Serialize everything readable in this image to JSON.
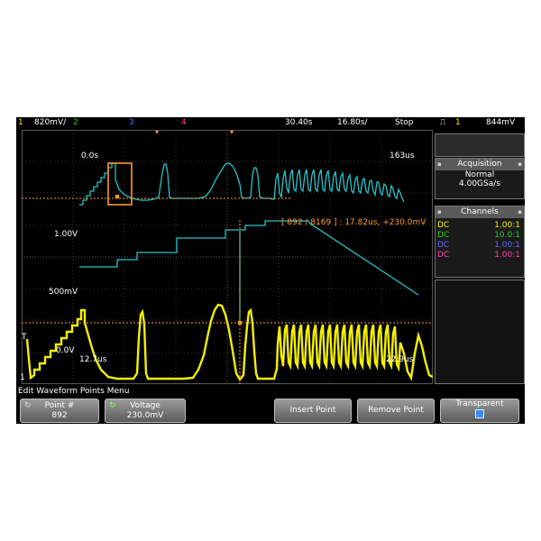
{
  "status_bar": {
    "ch1_num": "1",
    "ch1_scale": "820mV/",
    "ch2_num": "2",
    "ch3_num": "3",
    "ch4_num": "4",
    "timebase_delay": "30.40s",
    "timebase_scale": "16.80s/",
    "run_state": "Stop",
    "trigger_source": "1",
    "trigger_level": "844mV"
  },
  "waveform": {
    "time_start": "0.0s",
    "time_end": "163us",
    "ch_top_ref": "1.00V",
    "ch_mid_ref": "500mV",
    "zero_level": "0.0V",
    "cursor_left": "12.7us",
    "cursor_right": "22.9us",
    "point_readout": "[ 892 / 8169 ] : 17.82us, +230.0mV",
    "ground_marker": "1",
    "trigger_marker": "T"
  },
  "acquisition": {
    "title": "Acquisition",
    "mode": "Normal",
    "rate": "4.00GSa/s"
  },
  "channels": {
    "title": "Channels",
    "rows": [
      {
        "coupling": "DC",
        "ratio": "1.00:1",
        "color": "#f4f000"
      },
      {
        "coupling": "DC",
        "ratio": "10.0:1",
        "color": "#29d31f"
      },
      {
        "coupling": "DC",
        "ratio": "1.00:1",
        "color": "#5f6bff"
      },
      {
        "coupling": "DC",
        "ratio": "1.00:1",
        "color": "#ff3fa6"
      }
    ]
  },
  "menu": {
    "title": "Edit Waveform Points Menu",
    "point_label": "Point #",
    "point_value": "892",
    "voltage_label": "Voltage",
    "voltage_value": "230.0mV",
    "insert_label": "Insert Point",
    "remove_label": "Remove Point",
    "transparent_label": "Transparent"
  },
  "colors": {
    "ch1": "#f4f000",
    "ch3_trace": "#27c3c9",
    "cursor": "#ff9a2e"
  }
}
